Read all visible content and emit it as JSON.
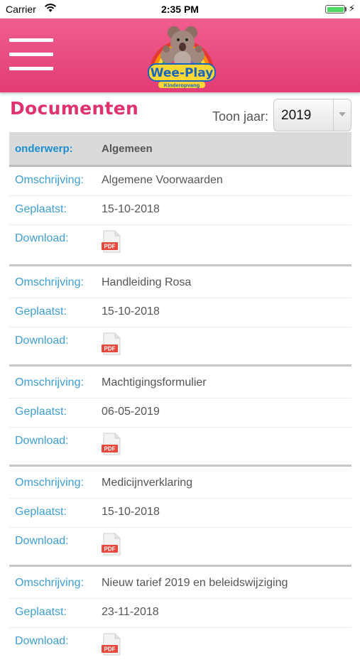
{
  "status": {
    "carrier": "Carrier",
    "time": "2:35 PM",
    "battery_level": 1.0
  },
  "header": {
    "menu_icon": "hamburger-menu-icon",
    "logo": {
      "brand": "Wee-Play",
      "tagline": "Kinderopvang"
    },
    "color": "#e8457b"
  },
  "page": {
    "title": "Documenten",
    "year_label": "Toon jaar:",
    "year_value": "2019"
  },
  "table": {
    "header_key": "onderwerp:",
    "header_value": "Algemeen",
    "labels": {
      "description": "Omschrijving:",
      "posted": "Geplaatst:",
      "download": "Download:"
    },
    "download_icon": "pdf-icon",
    "documents": [
      {
        "description": "Algemene Voorwaarden",
        "posted": "15-10-2018"
      },
      {
        "description": "Handleiding Rosa",
        "posted": "15-10-2018"
      },
      {
        "description": "Machtigingsformulier",
        "posted": "06-05-2019"
      },
      {
        "description": "Medicijnverklaring",
        "posted": "15-10-2018"
      },
      {
        "description": "Nieuw tarief 2019 en beleidswijziging",
        "posted": "23-11-2018"
      }
    ]
  },
  "colors": {
    "accent": "#e0336d",
    "label_blue": "#3d9fd5",
    "header_key_blue": "#1b8fd0",
    "pdf_red": "#e8473c"
  }
}
